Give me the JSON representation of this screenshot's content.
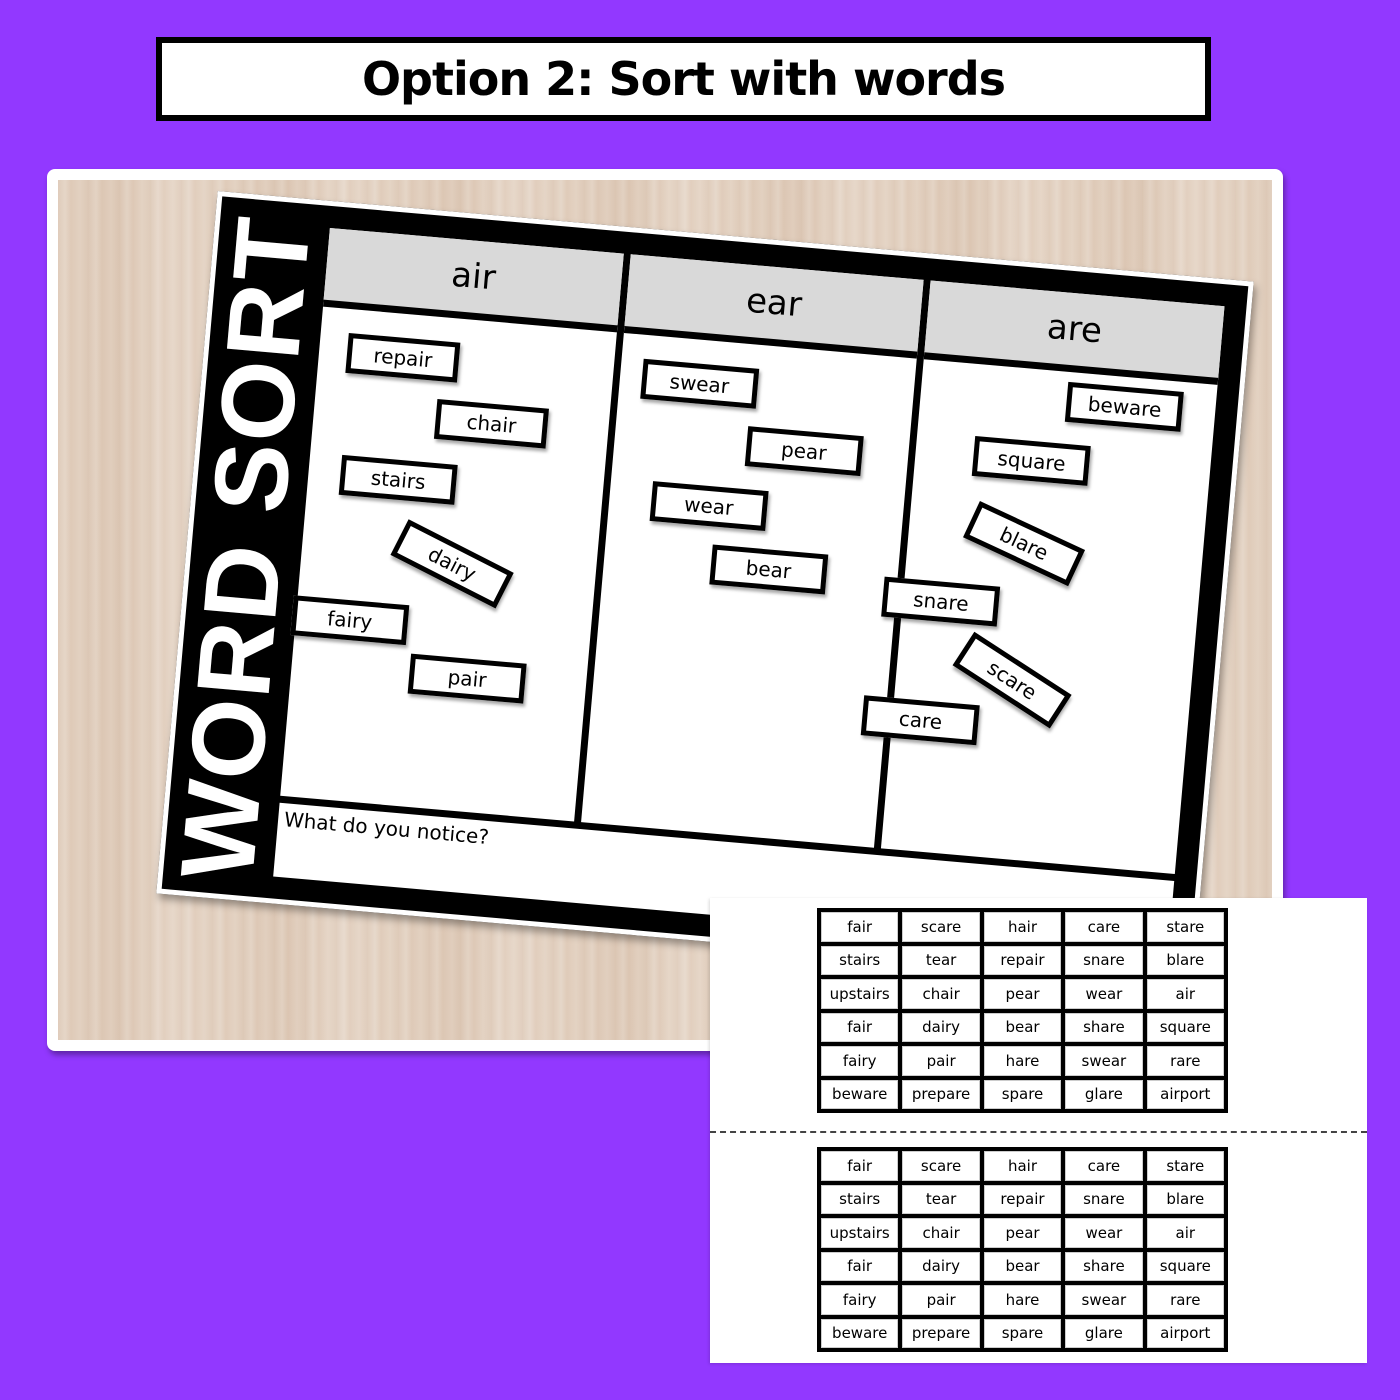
{
  "banner": {
    "title": "Option 2: Sort with words"
  },
  "board": {
    "side_title": "WORD SORT",
    "notice_prompt": "What do you notice?",
    "columns": [
      {
        "header": "air",
        "cards": [
          {
            "word": "repair",
            "tilt": 0
          },
          {
            "word": "chair",
            "tilt": 0
          },
          {
            "word": "stairs",
            "tilt": 0
          },
          {
            "word": "dairy",
            "tilt": 22
          },
          {
            "word": "fairy",
            "tilt": 0
          },
          {
            "word": "pair",
            "tilt": 0
          }
        ]
      },
      {
        "header": "ear",
        "cards": [
          {
            "word": "swear",
            "tilt": 0
          },
          {
            "word": "pear",
            "tilt": 0
          },
          {
            "word": "wear",
            "tilt": 0
          },
          {
            "word": "bear",
            "tilt": 0
          }
        ]
      },
      {
        "header": "are",
        "cards": [
          {
            "word": "beware",
            "tilt": 0
          },
          {
            "word": "square",
            "tilt": 0
          },
          {
            "word": "blare",
            "tilt": 20
          },
          {
            "word": "snare",
            "tilt": 0
          },
          {
            "word": "scare",
            "tilt": 28
          },
          {
            "word": "care",
            "tilt": 0
          }
        ]
      }
    ]
  },
  "printable": {
    "grids": [
      {
        "rows": [
          [
            "fair",
            "scare",
            "hair",
            "care",
            "stare"
          ],
          [
            "stairs",
            "tear",
            "repair",
            "snare",
            "blare"
          ],
          [
            "upstairs",
            "chair",
            "pear",
            "wear",
            "air"
          ],
          [
            "fair",
            "dairy",
            "bear",
            "share",
            "square"
          ],
          [
            "fairy",
            "pair",
            "hare",
            "swear",
            "rare"
          ],
          [
            "beware",
            "prepare",
            "spare",
            "glare",
            "airport"
          ]
        ]
      },
      {
        "rows": [
          [
            "fair",
            "scare",
            "hair",
            "care",
            "stare"
          ],
          [
            "stairs",
            "tear",
            "repair",
            "snare",
            "blare"
          ],
          [
            "upstairs",
            "chair",
            "pear",
            "wear",
            "air"
          ],
          [
            "fair",
            "dairy",
            "bear",
            "share",
            "square"
          ],
          [
            "fairy",
            "pair",
            "hare",
            "swear",
            "rare"
          ],
          [
            "beware",
            "prepare",
            "spare",
            "glare",
            "airport"
          ]
        ]
      }
    ]
  }
}
